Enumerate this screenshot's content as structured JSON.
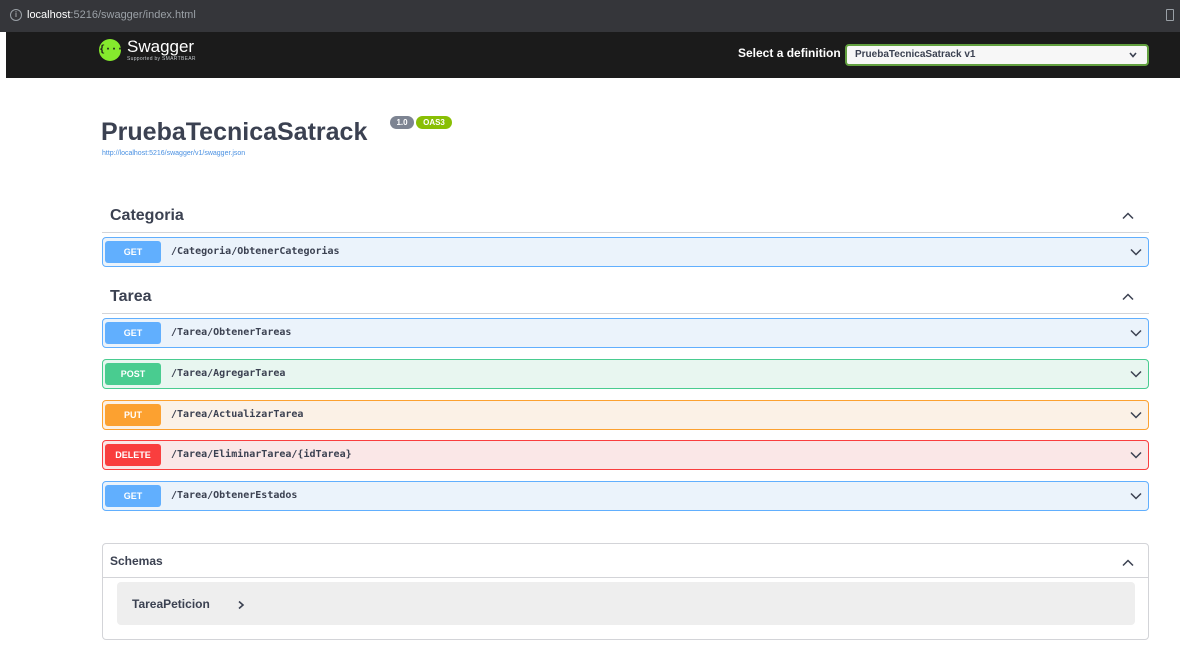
{
  "browser": {
    "host": "localhost",
    "path": ":5216/swagger/index.html",
    "info_icon": "info-icon"
  },
  "topbar": {
    "logo_symbol": "{···}",
    "logo_text": "Swagger",
    "logo_sub": "Supported by SMARTBEAR",
    "select_label": "Select a definition",
    "select_value": "PruebaTecnicaSatrack v1"
  },
  "info": {
    "title": "PruebaTecnicaSatrack",
    "version_badge": "1.0",
    "oas_badge": "OAS3",
    "spec_url": "http://localhost:5216/swagger/v1/swagger.json"
  },
  "tags": [
    {
      "name": "Categoria",
      "operations": [
        {
          "method": "GET",
          "path": "/Categoria/ObtenerCategorias"
        }
      ]
    },
    {
      "name": "Tarea",
      "operations": [
        {
          "method": "GET",
          "path": "/Tarea/ObtenerTareas"
        },
        {
          "method": "POST",
          "path": "/Tarea/AgregarTarea"
        },
        {
          "method": "PUT",
          "path": "/Tarea/ActualizarTarea"
        },
        {
          "method": "DELETE",
          "path": "/Tarea/EliminarTarea/{idTarea}"
        },
        {
          "method": "GET",
          "path": "/Tarea/ObtenerEstados"
        }
      ]
    }
  ],
  "schemas": {
    "title": "Schemas",
    "models": [
      "TareaPeticion"
    ]
  },
  "colors": {
    "get": "#61affe",
    "post": "#49cc90",
    "put": "#fca130",
    "delete": "#f93e3e",
    "topbar": "#1b1b1b",
    "logo": "#85ea2d"
  }
}
